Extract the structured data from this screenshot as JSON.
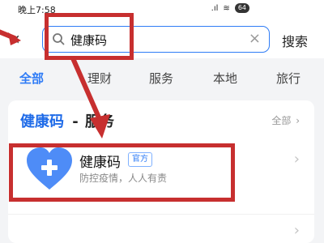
{
  "status_bar": {
    "time": "晚上7:58",
    "signal": "..ll",
    "wifi": "wifi",
    "battery": "64"
  },
  "header": {
    "search_text": "健康码",
    "clear_icon": "×",
    "search_button": "搜索"
  },
  "tabs": [
    "全部",
    "理财",
    "服务",
    "本地",
    "旅行"
  ],
  "section": {
    "title": "健康码",
    "dash": "-",
    "subtitle": "服务",
    "more": "全部"
  },
  "result_item": {
    "title": "健康码",
    "badge": "官方",
    "subtitle": "防控疫情，人人有责"
  },
  "colors": {
    "accent": "#2f7cf6",
    "annotation": "#c72f2f",
    "background": "#f3f4f6"
  }
}
